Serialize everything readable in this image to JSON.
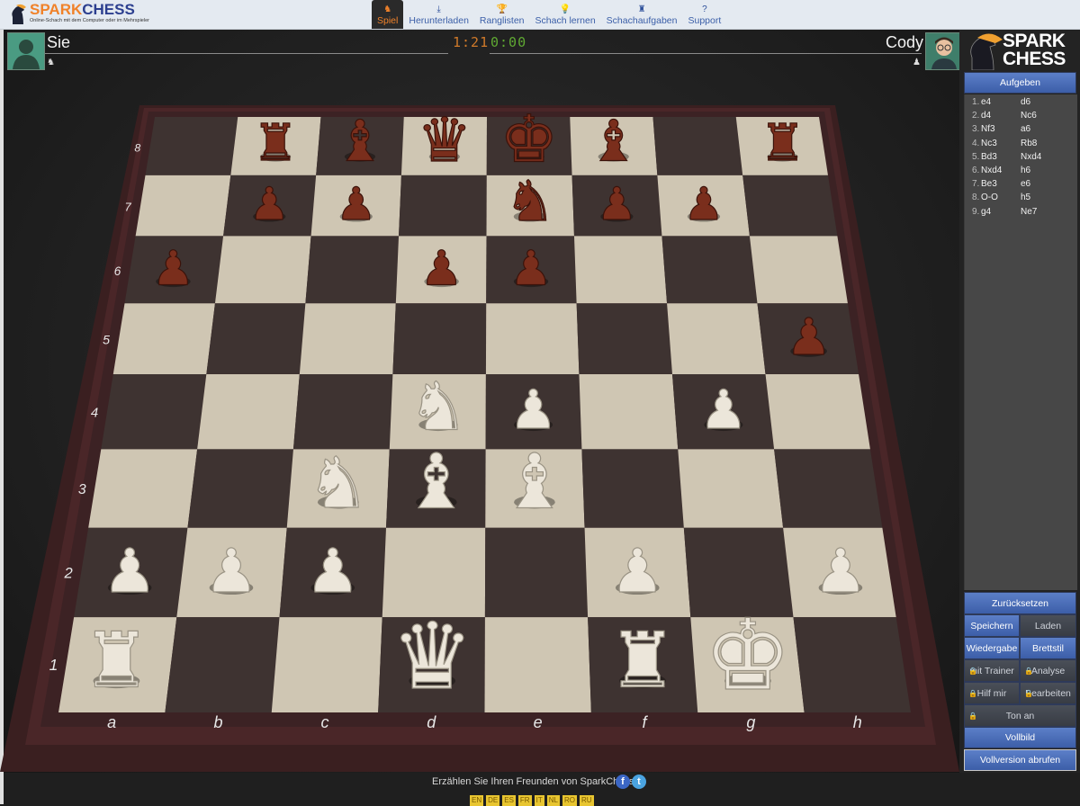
{
  "app": {
    "brand_spark": "SPARK",
    "brand_chess": "CHESS",
    "tagline": "Online-Schach mit dem Computer oder im Mehrspieler"
  },
  "nav": [
    {
      "label": "Spiel",
      "icon": "game-icon",
      "glyph": "♞",
      "active": true
    },
    {
      "label": "Herunterladen",
      "icon": "download-icon",
      "glyph": "⤓",
      "active": false
    },
    {
      "label": "Ranglisten",
      "icon": "trophy-icon",
      "glyph": "🏆",
      "active": false
    },
    {
      "label": "Schach lernen",
      "icon": "lightbulb-icon",
      "glyph": "💡",
      "active": false
    },
    {
      "label": "Schachaufgaben",
      "icon": "puzzle-icon",
      "glyph": "♜",
      "active": false
    },
    {
      "label": "Support",
      "icon": "help-icon",
      "glyph": "?",
      "active": false
    }
  ],
  "players": {
    "you": {
      "name": "Sie",
      "clock": "1:21",
      "side_glyph": "♞"
    },
    "opponent": {
      "name": "Cody",
      "clock": "0:00",
      "side_glyph": "♟"
    }
  },
  "sidebar": {
    "brand_line1": "SPARK",
    "brand_line2": "CHESS",
    "resign": "Aufgeben",
    "moves": [
      {
        "n": "1.",
        "w": "e4",
        "b": "d6"
      },
      {
        "n": "2.",
        "w": "d4",
        "b": "Nc6"
      },
      {
        "n": "3.",
        "w": "Nf3",
        "b": "a6"
      },
      {
        "n": "4.",
        "w": "Nc3",
        "b": "Rb8"
      },
      {
        "n": "5.",
        "w": "Bd3",
        "b": "Nxd4"
      },
      {
        "n": "6.",
        "w": "Nxd4",
        "b": "h6"
      },
      {
        "n": "7.",
        "w": "Be3",
        "b": "e6"
      },
      {
        "n": "8.",
        "w": "O-O",
        "b": "h5"
      },
      {
        "n": "9.",
        "w": "g4",
        "b": "Ne7"
      }
    ],
    "buttons": {
      "reset": "Zurücksetzen",
      "save": "Speichern",
      "load": "Laden",
      "replay": "Wiedergabe",
      "board_style": "Brettstil",
      "with_trainer": "mit Trainer",
      "analysis": "Analyse",
      "help_me": "Hilf mir",
      "edit": "Bearbeiten",
      "sound_on": "Ton an",
      "fullscreen": "Vollbild",
      "full_version": "Vollversion abrufen"
    }
  },
  "board": {
    "files": [
      "a",
      "b",
      "c",
      "d",
      "e",
      "f",
      "g",
      "h"
    ],
    "ranks": [
      "1",
      "2",
      "3",
      "4",
      "5",
      "6",
      "7",
      "8"
    ],
    "light_color": "#cfc6b3",
    "dark_color": "#3e3331",
    "frame_color": "#4a2a2a",
    "pieces": [
      {
        "sq": "b8",
        "color": "black",
        "type": "rook"
      },
      {
        "sq": "c8",
        "color": "black",
        "type": "bishop"
      },
      {
        "sq": "d8",
        "color": "black",
        "type": "queen"
      },
      {
        "sq": "e8",
        "color": "black",
        "type": "king"
      },
      {
        "sq": "f8",
        "color": "black",
        "type": "bishop"
      },
      {
        "sq": "h8",
        "color": "black",
        "type": "rook"
      },
      {
        "sq": "b7",
        "color": "black",
        "type": "pawn"
      },
      {
        "sq": "c7",
        "color": "black",
        "type": "pawn"
      },
      {
        "sq": "e7",
        "color": "black",
        "type": "knight"
      },
      {
        "sq": "f7",
        "color": "black",
        "type": "pawn"
      },
      {
        "sq": "g7",
        "color": "black",
        "type": "pawn"
      },
      {
        "sq": "a6",
        "color": "black",
        "type": "pawn"
      },
      {
        "sq": "d6",
        "color": "black",
        "type": "pawn"
      },
      {
        "sq": "e6",
        "color": "black",
        "type": "pawn"
      },
      {
        "sq": "h5",
        "color": "black",
        "type": "pawn"
      },
      {
        "sq": "d4",
        "color": "white",
        "type": "knight"
      },
      {
        "sq": "e4",
        "color": "white",
        "type": "pawn"
      },
      {
        "sq": "g4",
        "color": "white",
        "type": "pawn"
      },
      {
        "sq": "c3",
        "color": "white",
        "type": "knight"
      },
      {
        "sq": "d3",
        "color": "white",
        "type": "bishop"
      },
      {
        "sq": "e3",
        "color": "white",
        "type": "bishop"
      },
      {
        "sq": "a2",
        "color": "white",
        "type": "pawn"
      },
      {
        "sq": "b2",
        "color": "white",
        "type": "pawn"
      },
      {
        "sq": "c2",
        "color": "white",
        "type": "pawn"
      },
      {
        "sq": "f2",
        "color": "white",
        "type": "pawn"
      },
      {
        "sq": "h2",
        "color": "white",
        "type": "pawn"
      },
      {
        "sq": "a1",
        "color": "white",
        "type": "rook"
      },
      {
        "sq": "d1",
        "color": "white",
        "type": "queen"
      },
      {
        "sq": "f1",
        "color": "white",
        "type": "rook"
      },
      {
        "sq": "g1",
        "color": "white",
        "type": "king"
      }
    ]
  },
  "footer": {
    "share_text": "Erzählen Sie Ihren Freunden von SparkChess:",
    "facebook": "f",
    "twitter": "t",
    "languages": [
      "EN",
      "DE",
      "ES",
      "FR",
      "IT",
      "NL",
      "RO",
      "RU"
    ]
  }
}
